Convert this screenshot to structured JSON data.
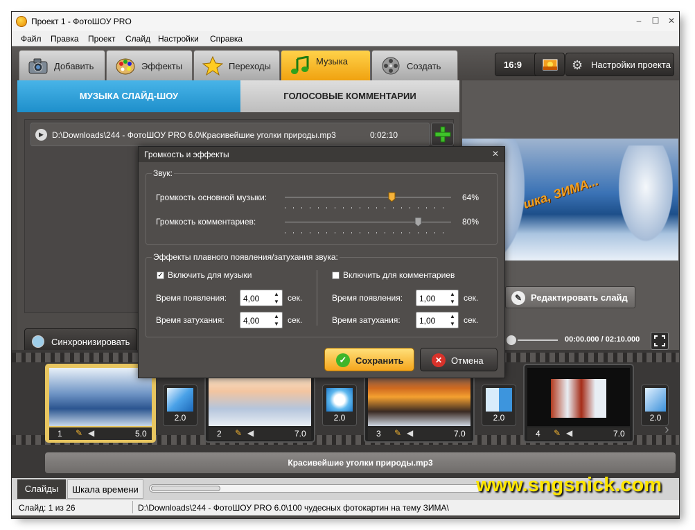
{
  "window": {
    "title": "Проект 1 - ФотоШОУ PRO",
    "min": "–",
    "max": "☐",
    "close": "✕"
  },
  "menu": [
    "Файл",
    "Правка",
    "Проект",
    "Слайд",
    "Настройки",
    "Справка"
  ],
  "tabs": [
    {
      "label": "Добавить",
      "icon": "camera-icon"
    },
    {
      "label": "Эффекты",
      "icon": "palette-icon"
    },
    {
      "label": "Переходы",
      "icon": "star-icon"
    },
    {
      "label": "Музыка",
      "icon": "music-note-icon",
      "active": true
    },
    {
      "label": "Создать",
      "icon": "film-reel-icon"
    }
  ],
  "toolbar": {
    "aspect": "16:9",
    "project_settings": "Настройки проекта"
  },
  "subtabs": {
    "music": "МУЗЫКА СЛАЙД-ШОУ",
    "voice": "ГОЛОСОВЫЕ КОММЕНТАРИИ"
  },
  "track": {
    "path": "D:\\Downloads\\244 - ФотоШОУ PRO 6.0\\Красивейшие уголки природы.mp3",
    "duration": "0:02:10"
  },
  "sync_button": "Синхронизировать",
  "preview": {
    "caption": "шка, ЗИМА...",
    "edit_slide": "Редактировать слайд",
    "time": "00:00.000 / 02:10.000"
  },
  "dialog": {
    "title": "Громкость и эффекты",
    "close": "✕",
    "sound_group": "Звук:",
    "music_volume_label": "Громкость основной музыки:",
    "music_volume": "64%",
    "music_volume_level": 0.64,
    "comment_volume_label": "Громкость комментариев:",
    "comment_volume": "80%",
    "comment_volume_level": 0.8,
    "fade_group": "Эффекты плавного появления/затухания звука:",
    "enable_music": "Включить для музыки",
    "enable_music_checked": true,
    "enable_comments": "Включить для комментариев",
    "enable_comments_checked": false,
    "fade_in_label": "Время появления:",
    "fade_out_label": "Время затухания:",
    "music_fade_in": "4,00",
    "music_fade_out": "4,00",
    "comment_fade_in": "1,00",
    "comment_fade_out": "1,00",
    "sec": "сек.",
    "save": "Сохранить",
    "cancel": "Отмена"
  },
  "slides": [
    {
      "num": "1",
      "dur": "5.0"
    },
    {
      "num": "2",
      "dur": "7.0"
    },
    {
      "num": "3",
      "dur": "7.0"
    },
    {
      "num": "4",
      "dur": "7.0"
    }
  ],
  "transitions": [
    "2.0",
    "2.0",
    "2.0",
    "2.0"
  ],
  "audio_track_name": "Красивейшие уголки природы.mp3",
  "bottom_tabs": [
    "Слайды",
    "Шкала времени"
  ],
  "watermark": "www.sngsnick.com",
  "status": {
    "slide": "Слайд: 1 из 26",
    "path": "D:\\Downloads\\244 - ФотоШОУ PRO 6.0\\100 чудесных фотокартин на тему ЗИМА\\"
  }
}
